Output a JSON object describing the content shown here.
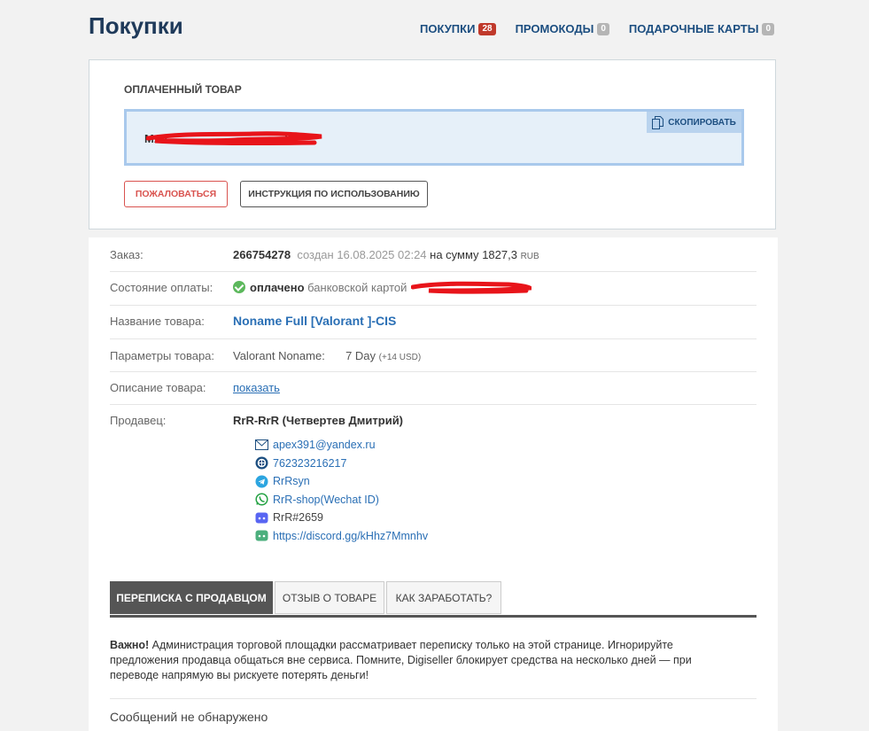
{
  "page": {
    "title": "Покупки"
  },
  "topnav": [
    {
      "label": "ПОКУПКИ",
      "count": "28",
      "color": "#c0392b"
    },
    {
      "label": "ПРОМОКОДЫ",
      "count": "0",
      "color": "#b5b5b5"
    },
    {
      "label": "ПОДАРОЧНЫЕ КАРТЫ",
      "count": "0",
      "color": "#b5b5b5"
    }
  ],
  "paid": {
    "title": "ОПЛАЧЕННЫЙ ТОВАР",
    "code_value": "MA7",
    "code_value_tail": "X",
    "copy_label": "СКОПИРОВАТЬ",
    "complain_label": "ПОЖАЛОВАТЬСЯ",
    "instructions_label": "ИНСТРУКЦИЯ ПО ИСПОЛЬЗОВАНИЮ"
  },
  "order": {
    "label": "Заказ:",
    "number": "266754278",
    "created": "создан 16.08.2025 02:24",
    "sum_prefix": "на сумму",
    "sum": "1827,3",
    "currency": "RUB"
  },
  "payment": {
    "label": "Состояние оплаты:",
    "status": "оплачено",
    "method": "банковской картой"
  },
  "product": {
    "label": "Название товара:",
    "name": "Noname Full [Valorant ]-CIS"
  },
  "params": {
    "label": "Параметры товара:",
    "param_name": "Valorant Noname:",
    "param_value": "7 Day",
    "param_extra": "(+14 USD)"
  },
  "description": {
    "label": "Описание товара:",
    "link": "показать"
  },
  "seller": {
    "label": "Продавец:",
    "name": "RrR-RrR (Четвертев Дмитрий)",
    "contacts": [
      {
        "icon": "mail-icon",
        "text": "apex391@yandex.ru"
      },
      {
        "icon": "webmoney-icon",
        "text": "762323216217"
      },
      {
        "icon": "telegram-icon",
        "text": "RrRsyn"
      },
      {
        "icon": "whatsapp-icon",
        "text": "RrR-shop(Wechat ID)"
      },
      {
        "icon": "discord-icon",
        "text": "RrR#2659"
      },
      {
        "icon": "discord-link-icon",
        "text": "https://discord.gg/kHhz7Mmnhv"
      }
    ]
  },
  "tabs": [
    {
      "label": "ПЕРЕПИСКА С ПРОДАВЦОМ"
    },
    {
      "label": "ОТЗЫВ О ТОВАРЕ"
    },
    {
      "label": "КАК ЗАРАБОТАТЬ?"
    }
  ],
  "notice": {
    "bold": "Важно!",
    "text": " Администрация торговой площадки рассматривает переписку только на этой странице. Игнорируйте предложения продавца общаться вне сервиса. Помните, Digiseller блокирует средства на несколько дней — при переводе напрямую вы рискуете потерять деньги!"
  },
  "messages": {
    "empty": "Сообщений не обнаружено"
  }
}
